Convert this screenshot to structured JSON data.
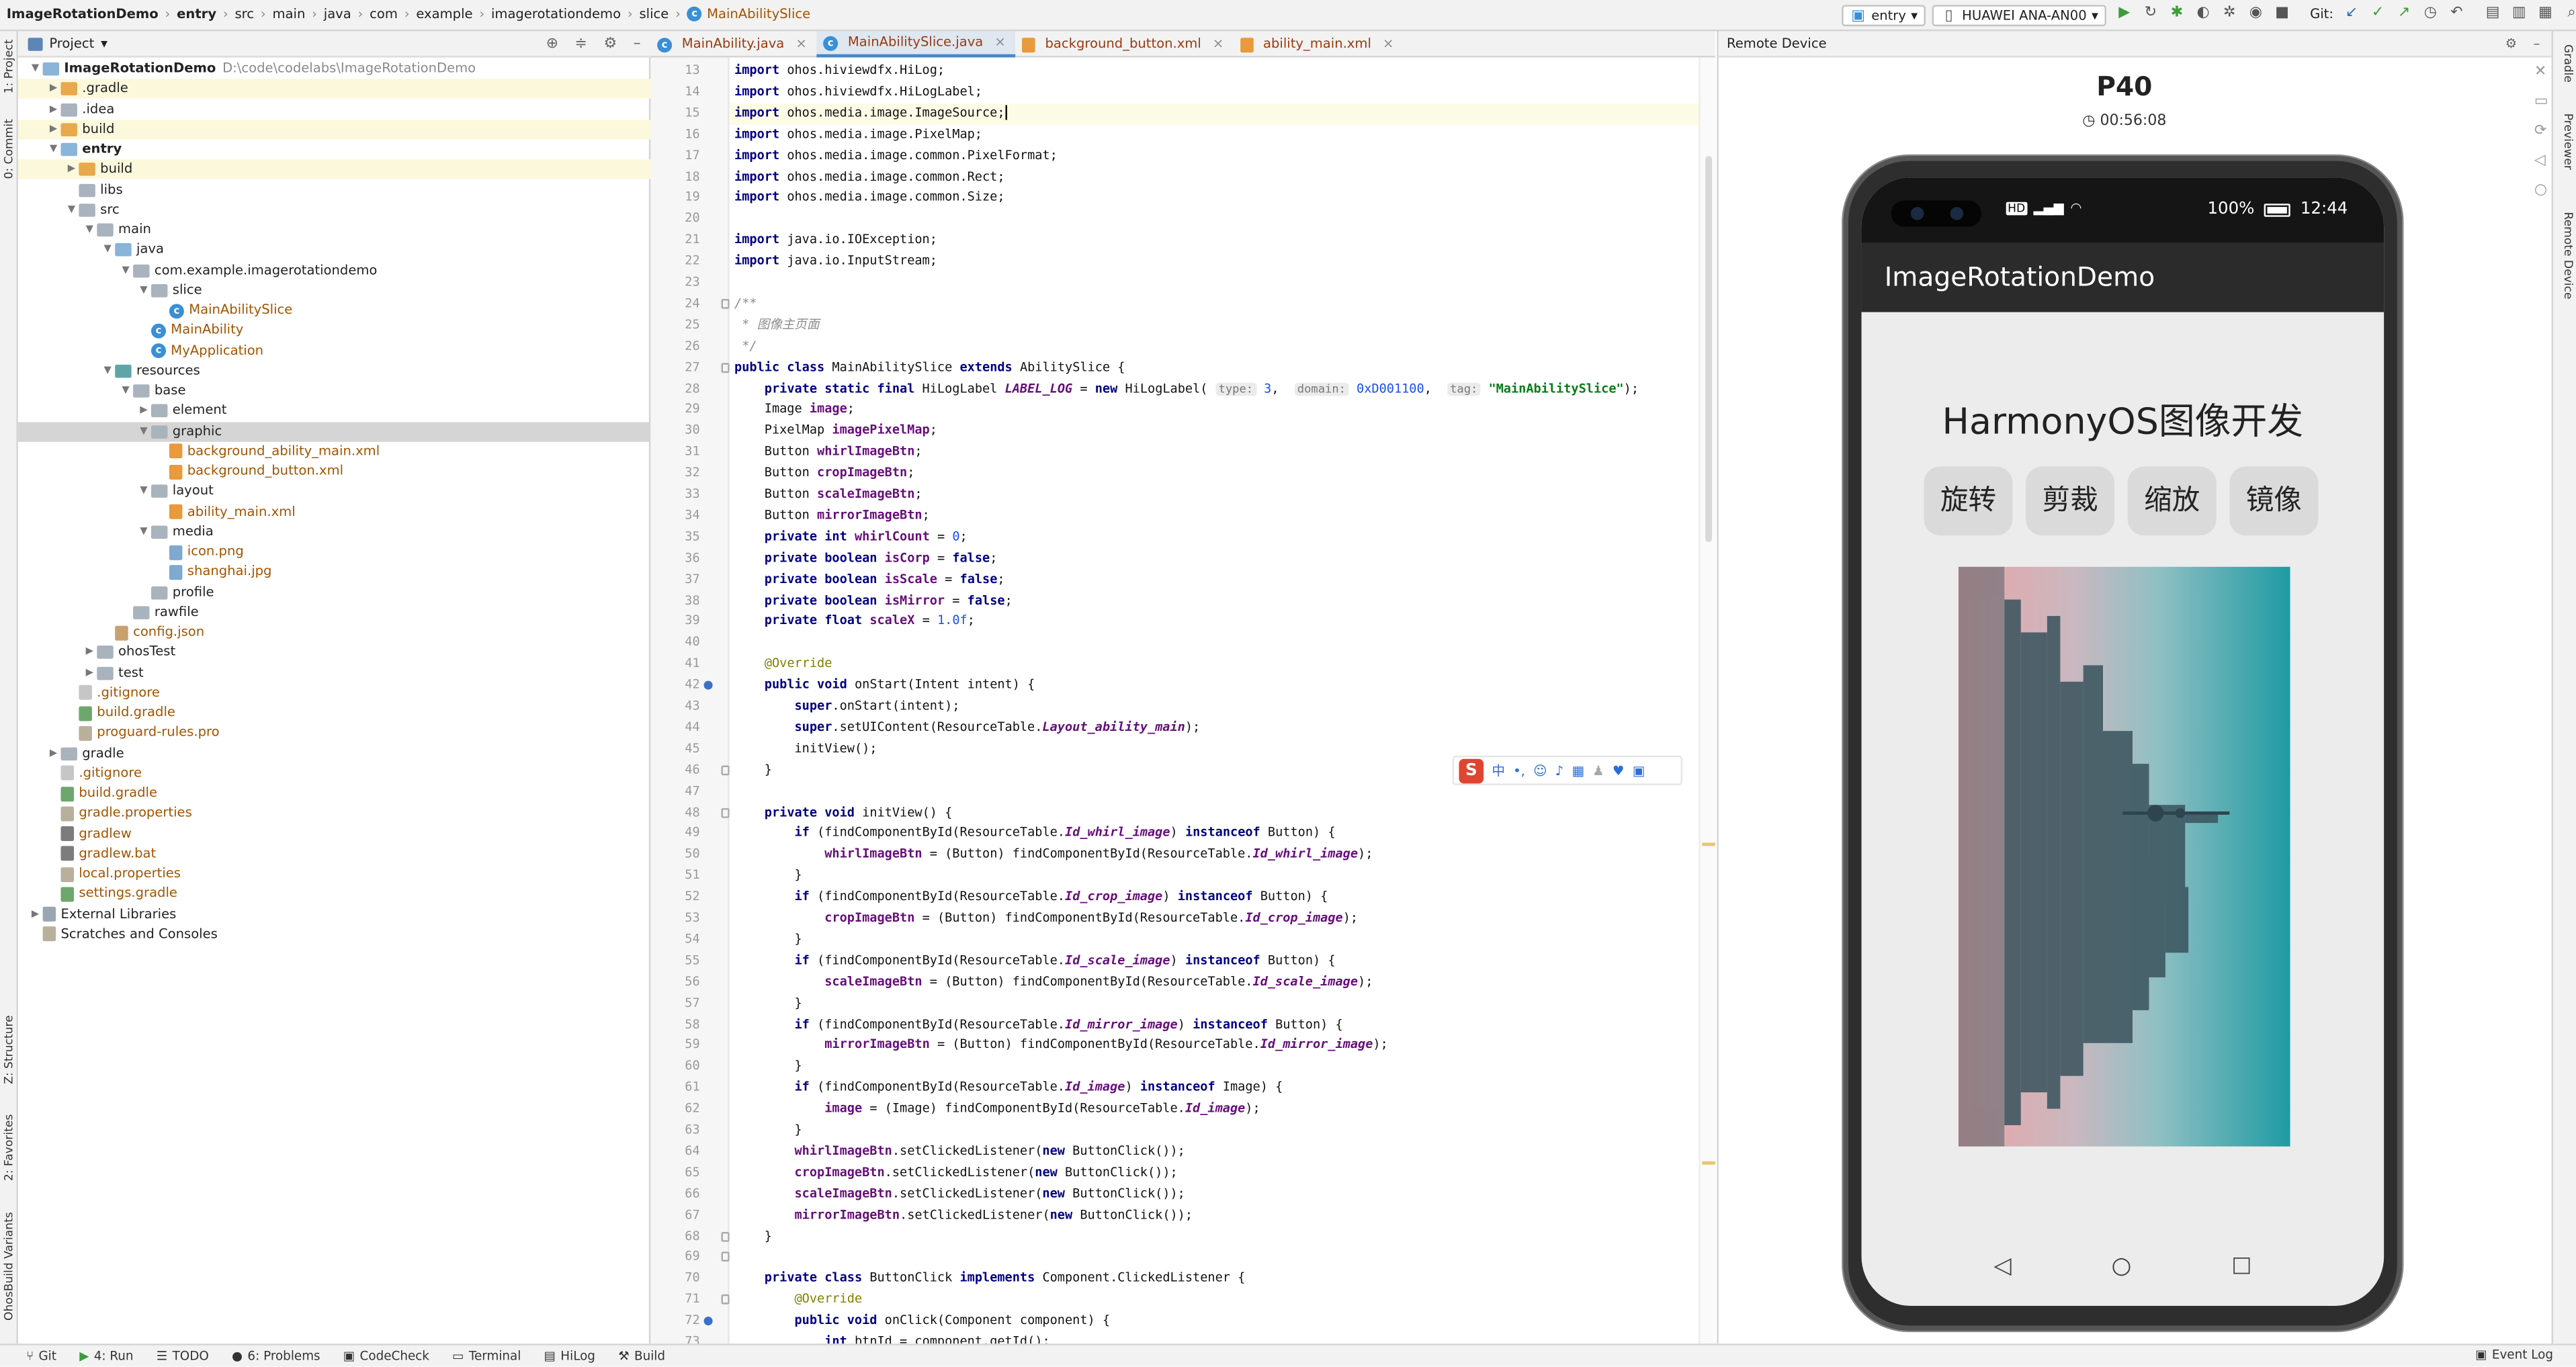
{
  "breadcrumbs": [
    "ImageRotationDemo",
    "entry",
    "src",
    "main",
    "java",
    "com",
    "example",
    "imagerotationdemo",
    "slice",
    "MainAbilitySlice"
  ],
  "toolbar": {
    "run_config": "entry",
    "device": "HUAWEI ANA-AN00",
    "git_label": "Git:"
  },
  "project_panel": {
    "title": "Project"
  },
  "tree": [
    {
      "depth": 0,
      "arrow": "open",
      "icon": "module",
      "name": "ImageRotationDemo",
      "path": "D:\\code\\codelabs\\ImageRotationDemo",
      "bold": true
    },
    {
      "depth": 1,
      "arrow": "closed",
      "icon": "folder-orange",
      "name": ".gradle",
      "hl": true
    },
    {
      "depth": 1,
      "arrow": "closed",
      "icon": "folder-gray",
      "name": ".idea"
    },
    {
      "depth": 1,
      "arrow": "closed",
      "icon": "folder-orange",
      "name": "build",
      "hl": true
    },
    {
      "depth": 1,
      "arrow": "open",
      "icon": "folder-blue",
      "name": "entry",
      "bold": true
    },
    {
      "depth": 2,
      "arrow": "closed",
      "icon": "folder-orange",
      "name": "build",
      "hl": true
    },
    {
      "depth": 2,
      "arrow": "none",
      "icon": "folder-gray",
      "name": "libs"
    },
    {
      "depth": 2,
      "arrow": "open",
      "icon": "folder-gray",
      "name": "src"
    },
    {
      "depth": 3,
      "arrow": "open",
      "icon": "folder-gray",
      "name": "main"
    },
    {
      "depth": 4,
      "arrow": "open",
      "icon": "folder-blue",
      "name": "java"
    },
    {
      "depth": 5,
      "arrow": "open",
      "icon": "folder-gray",
      "name": "com.example.imagerotationdemo"
    },
    {
      "depth": 6,
      "arrow": "open",
      "icon": "folder-gray",
      "name": "slice"
    },
    {
      "depth": 7,
      "arrow": "none",
      "icon": "class",
      "name": "MainAbilitySlice",
      "type": "java"
    },
    {
      "depth": 6,
      "arrow": "none",
      "icon": "class",
      "name": "MainAbility",
      "type": "java"
    },
    {
      "depth": 6,
      "arrow": "none",
      "icon": "class",
      "name": "MyApplication",
      "type": "java"
    },
    {
      "depth": 4,
      "arrow": "open",
      "icon": "folder-teal",
      "name": "resources"
    },
    {
      "depth": 5,
      "arrow": "open",
      "icon": "folder-gray",
      "name": "base"
    },
    {
      "depth": 6,
      "arrow": "closed",
      "icon": "folder-gray",
      "name": "element"
    },
    {
      "depth": 6,
      "arrow": "open",
      "icon": "folder-gray",
      "name": "graphic",
      "sel": true
    },
    {
      "depth": 7,
      "arrow": "none",
      "icon": "xml",
      "name": "background_ability_main.xml",
      "type": "file"
    },
    {
      "depth": 7,
      "arrow": "none",
      "icon": "xml",
      "name": "background_button.xml",
      "type": "file"
    },
    {
      "depth": 6,
      "arrow": "open",
      "icon": "folder-gray",
      "name": "layout"
    },
    {
      "depth": 7,
      "arrow": "none",
      "icon": "xml",
      "name": "ability_main.xml",
      "type": "file"
    },
    {
      "depth": 6,
      "arrow": "open",
      "icon": "folder-gray",
      "name": "media"
    },
    {
      "depth": 7,
      "arrow": "none",
      "icon": "img",
      "name": "icon.png",
      "type": "file"
    },
    {
      "depth": 7,
      "arrow": "none",
      "icon": "img",
      "name": "shanghai.jpg",
      "type": "file"
    },
    {
      "depth": 6,
      "arrow": "none",
      "icon": "folder-gray",
      "name": "profile"
    },
    {
      "depth": 5,
      "arrow": "none",
      "icon": "folder-gray",
      "name": "rawfile"
    },
    {
      "depth": 4,
      "arrow": "none",
      "icon": "json",
      "name": "config.json",
      "type": "file"
    },
    {
      "depth": 3,
      "arrow": "closed",
      "icon": "folder-gray",
      "name": "ohosTest"
    },
    {
      "depth": 3,
      "arrow": "closed",
      "icon": "folder-gray",
      "name": "test"
    },
    {
      "depth": 2,
      "arrow": "none",
      "icon": "git",
      "name": ".gitignore",
      "type": "file"
    },
    {
      "depth": 2,
      "arrow": "none",
      "icon": "gradle",
      "name": "build.gradle",
      "type": "file"
    },
    {
      "depth": 2,
      "arrow": "none",
      "icon": "prop",
      "name": "proguard-rules.pro",
      "type": "file"
    },
    {
      "depth": 1,
      "arrow": "closed",
      "icon": "folder-gray",
      "name": "gradle"
    },
    {
      "depth": 1,
      "arrow": "none",
      "icon": "git",
      "name": ".gitignore",
      "type": "file"
    },
    {
      "depth": 1,
      "arrow": "none",
      "icon": "gradle",
      "name": "build.gradle",
      "type": "file"
    },
    {
      "depth": 1,
      "arrow": "none",
      "icon": "prop",
      "name": "gradle.properties",
      "type": "file"
    },
    {
      "depth": 1,
      "arrow": "none",
      "icon": "bat",
      "name": "gradlew",
      "type": "file"
    },
    {
      "depth": 1,
      "arrow": "none",
      "icon": "bat",
      "name": "gradlew.bat",
      "type": "file"
    },
    {
      "depth": 1,
      "arrow": "none",
      "icon": "prop",
      "name": "local.properties",
      "type": "file"
    },
    {
      "depth": 1,
      "arrow": "none",
      "icon": "gradle",
      "name": "settings.gradle",
      "type": "file"
    },
    {
      "depth": 0,
      "arrow": "closed",
      "icon": "lib",
      "name": "External Libraries"
    },
    {
      "depth": 0,
      "arrow": "none",
      "icon": "scratch",
      "name": "Scratches and Consoles"
    }
  ],
  "editor_tabs": [
    {
      "name": "MainAbility.java",
      "icon": "class",
      "active": false
    },
    {
      "name": "MainAbilitySlice.java",
      "icon": "class",
      "active": true
    },
    {
      "name": "background_button.xml",
      "icon": "xml",
      "active": false
    },
    {
      "name": "ability_main.xml",
      "icon": "xml",
      "active": false
    }
  ],
  "warnings": "2",
  "code_start_line": 13,
  "code_lines": [
    "<span class='kw'>import</span> ohos.hiviewdfx.HiLog;",
    "<span class='kw'>import</span> ohos.hiviewdfx.HiLogLabel;",
    "<span class='kw'>import</span> ohos.media.image.ImageSource;",
    "<span class='kw'>import</span> ohos.media.image.PixelMap;",
    "<span class='kw'>import</span> ohos.media.image.common.PixelFormat;",
    "<span class='kw'>import</span> ohos.media.image.common.Rect;",
    "<span class='kw'>import</span> ohos.media.image.common.Size;",
    "",
    "<span class='kw'>import</span> java.io.IOException;",
    "<span class='kw'>import</span> java.io.InputStream;",
    "",
    "<span class='cmt'>/**</span>",
    "<span class='cmt'> * 图像主页面</span>",
    "<span class='cmt'> */</span>",
    "<span class='kw'>public class</span> MainAbilitySlice <span class='kw'>extends</span> AbilitySlice {",
    "    <span class='kw'>private static final</span> HiLogLabel <span class='ifld'>LABEL_LOG</span> = <span class='kw'>new</span> HiLogLabel( <span class='hint'>type:</span> <span class='num'>3</span>,  <span class='hint'>domain:</span> <span class='num'>0xD001100</span>,  <span class='hint'>tag:</span> <span class='str'>\"MainAbilitySlice\"</span>);",
    "    Image <span class='fld'>image</span>;",
    "    PixelMap <span class='fld'>imagePixelMap</span>;",
    "    Button <span class='fld'>whirlImageBtn</span>;",
    "    Button <span class='fld'>cropImageBtn</span>;",
    "    Button <span class='fld'>scaleImageBtn</span>;",
    "    Button <span class='fld'>mirrorImageBtn</span>;",
    "    <span class='kw'>private int</span> <span class='fld'>whirlCount</span> = <span class='num'>0</span>;",
    "    <span class='kw'>private boolean</span> <span class='fld'>isCorp</span> = <span class='kw'>false</span>;",
    "    <span class='kw'>private boolean</span> <span class='fld'>isScale</span> = <span class='kw'>false</span>;",
    "    <span class='kw'>private boolean</span> <span class='fld'>isMirror</span> = <span class='kw'>false</span>;",
    "    <span class='kw'>private float</span> <span class='fld'>scaleX</span> = <span class='num'>1.0f</span>;",
    "",
    "    <span class='ann'>@Override</span>",
    "    <span class='kw'>public void</span> onStart(Intent intent) {",
    "        <span class='kw'>super</span>.onStart(intent);",
    "        <span class='kw'>super</span>.setUIContent(ResourceTable.<span class='ifld'>Layout_ability_main</span>);",
    "        initView();",
    "    }",
    "",
    "    <span class='kw'>private void</span> initView() {",
    "        <span class='kw'>if</span> (findComponentById(ResourceTable.<span class='ifld'>Id_whirl_image</span>) <span class='kw'>instanceof</span> Button) {",
    "            <span class='fld'>whirlImageBtn</span> = (Button) findComponentById(ResourceTable.<span class='ifld'>Id_whirl_image</span>);",
    "        }",
    "        <span class='kw'>if</span> (findComponentById(ResourceTable.<span class='ifld'>Id_crop_image</span>) <span class='kw'>instanceof</span> Button) {",
    "            <span class='fld'>cropImageBtn</span> = (Button) findComponentById(ResourceTable.<span class='ifld'>Id_crop_image</span>);",
    "        }",
    "        <span class='kw'>if</span> (findComponentById(ResourceTable.<span class='ifld'>Id_scale_image</span>) <span class='kw'>instanceof</span> Button) {",
    "            <span class='fld'>scaleImageBtn</span> = (Button) findComponentById(ResourceTable.<span class='ifld'>Id_scale_image</span>);",
    "        }",
    "        <span class='kw'>if</span> (findComponentById(ResourceTable.<span class='ifld'>Id_mirror_image</span>) <span class='kw'>instanceof</span> Button) {",
    "            <span class='fld'>mirrorImageBtn</span> = (Button) findComponentById(ResourceTable.<span class='ifld'>Id_mirror_image</span>);",
    "        }",
    "        <span class='kw'>if</span> (findComponentById(ResourceTable.<span class='ifld'>Id_image</span>) <span class='kw'>instanceof</span> Image) {",
    "            <span class='fld'>image</span> = (Image) findComponentById(ResourceTable.<span class='ifld'>Id_image</span>);",
    "        }",
    "        <span class='fld'>whirlImageBtn</span>.setClickedListener(<span class='kw'>new</span> ButtonClick());",
    "        <span class='fld'>cropImageBtn</span>.setClickedListener(<span class='kw'>new</span> ButtonClick());",
    "        <span class='fld'>scaleImageBtn</span>.setClickedListener(<span class='kw'>new</span> ButtonClick());",
    "        <span class='fld'>mirrorImageBtn</span>.setClickedListener(<span class='kw'>new</span> ButtonClick());",
    "    }",
    "",
    "    <span class='kw'>private class</span> ButtonClick <span class='kw'>implements</span> Component.ClickedListener {",
    "        <span class='ann'>@Override</span>",
    "        <span class='kw'>public void</span> onClick(Component component) {",
    "            <span class='kw'>int</span> btnId = component.getId();"
  ],
  "remote": {
    "title": "Remote Device",
    "device_name": "P40",
    "timer": "00:56:08",
    "status_battery": "100%",
    "status_time": "12:44",
    "app_bar_title": "ImageRotationDemo",
    "app_heading": "HarmonyOS图像开发",
    "buttons": [
      "旋转",
      "剪裁",
      "缩放",
      "镜像"
    ]
  },
  "left_stripe": [
    "1: Project",
    "0: Commit",
    "Z: Structure",
    "2: Favorites",
    "OhosBuild Variants"
  ],
  "right_stripe": [
    "Gradle",
    "Previewer",
    "Remote Device"
  ],
  "bottom_tools": [
    {
      "icon": "git-icon",
      "label": "Git"
    },
    {
      "icon": "run-icon",
      "label": "4: Run"
    },
    {
      "icon": "todo-icon",
      "label": "TODO"
    },
    {
      "icon": "problems-icon",
      "label": "6: Problems"
    },
    {
      "icon": "codecheck-icon",
      "label": "CodeCheck"
    },
    {
      "icon": "terminal-icon",
      "label": "Terminal"
    },
    {
      "icon": "hilog-icon",
      "label": "HiLog"
    },
    {
      "icon": "build-icon",
      "label": "Build"
    }
  ],
  "event_log": "Event Log",
  "colors": {
    "accent": "#4a88c7",
    "selection": "#d5d5d5",
    "highlight": "#fbf8dc"
  }
}
